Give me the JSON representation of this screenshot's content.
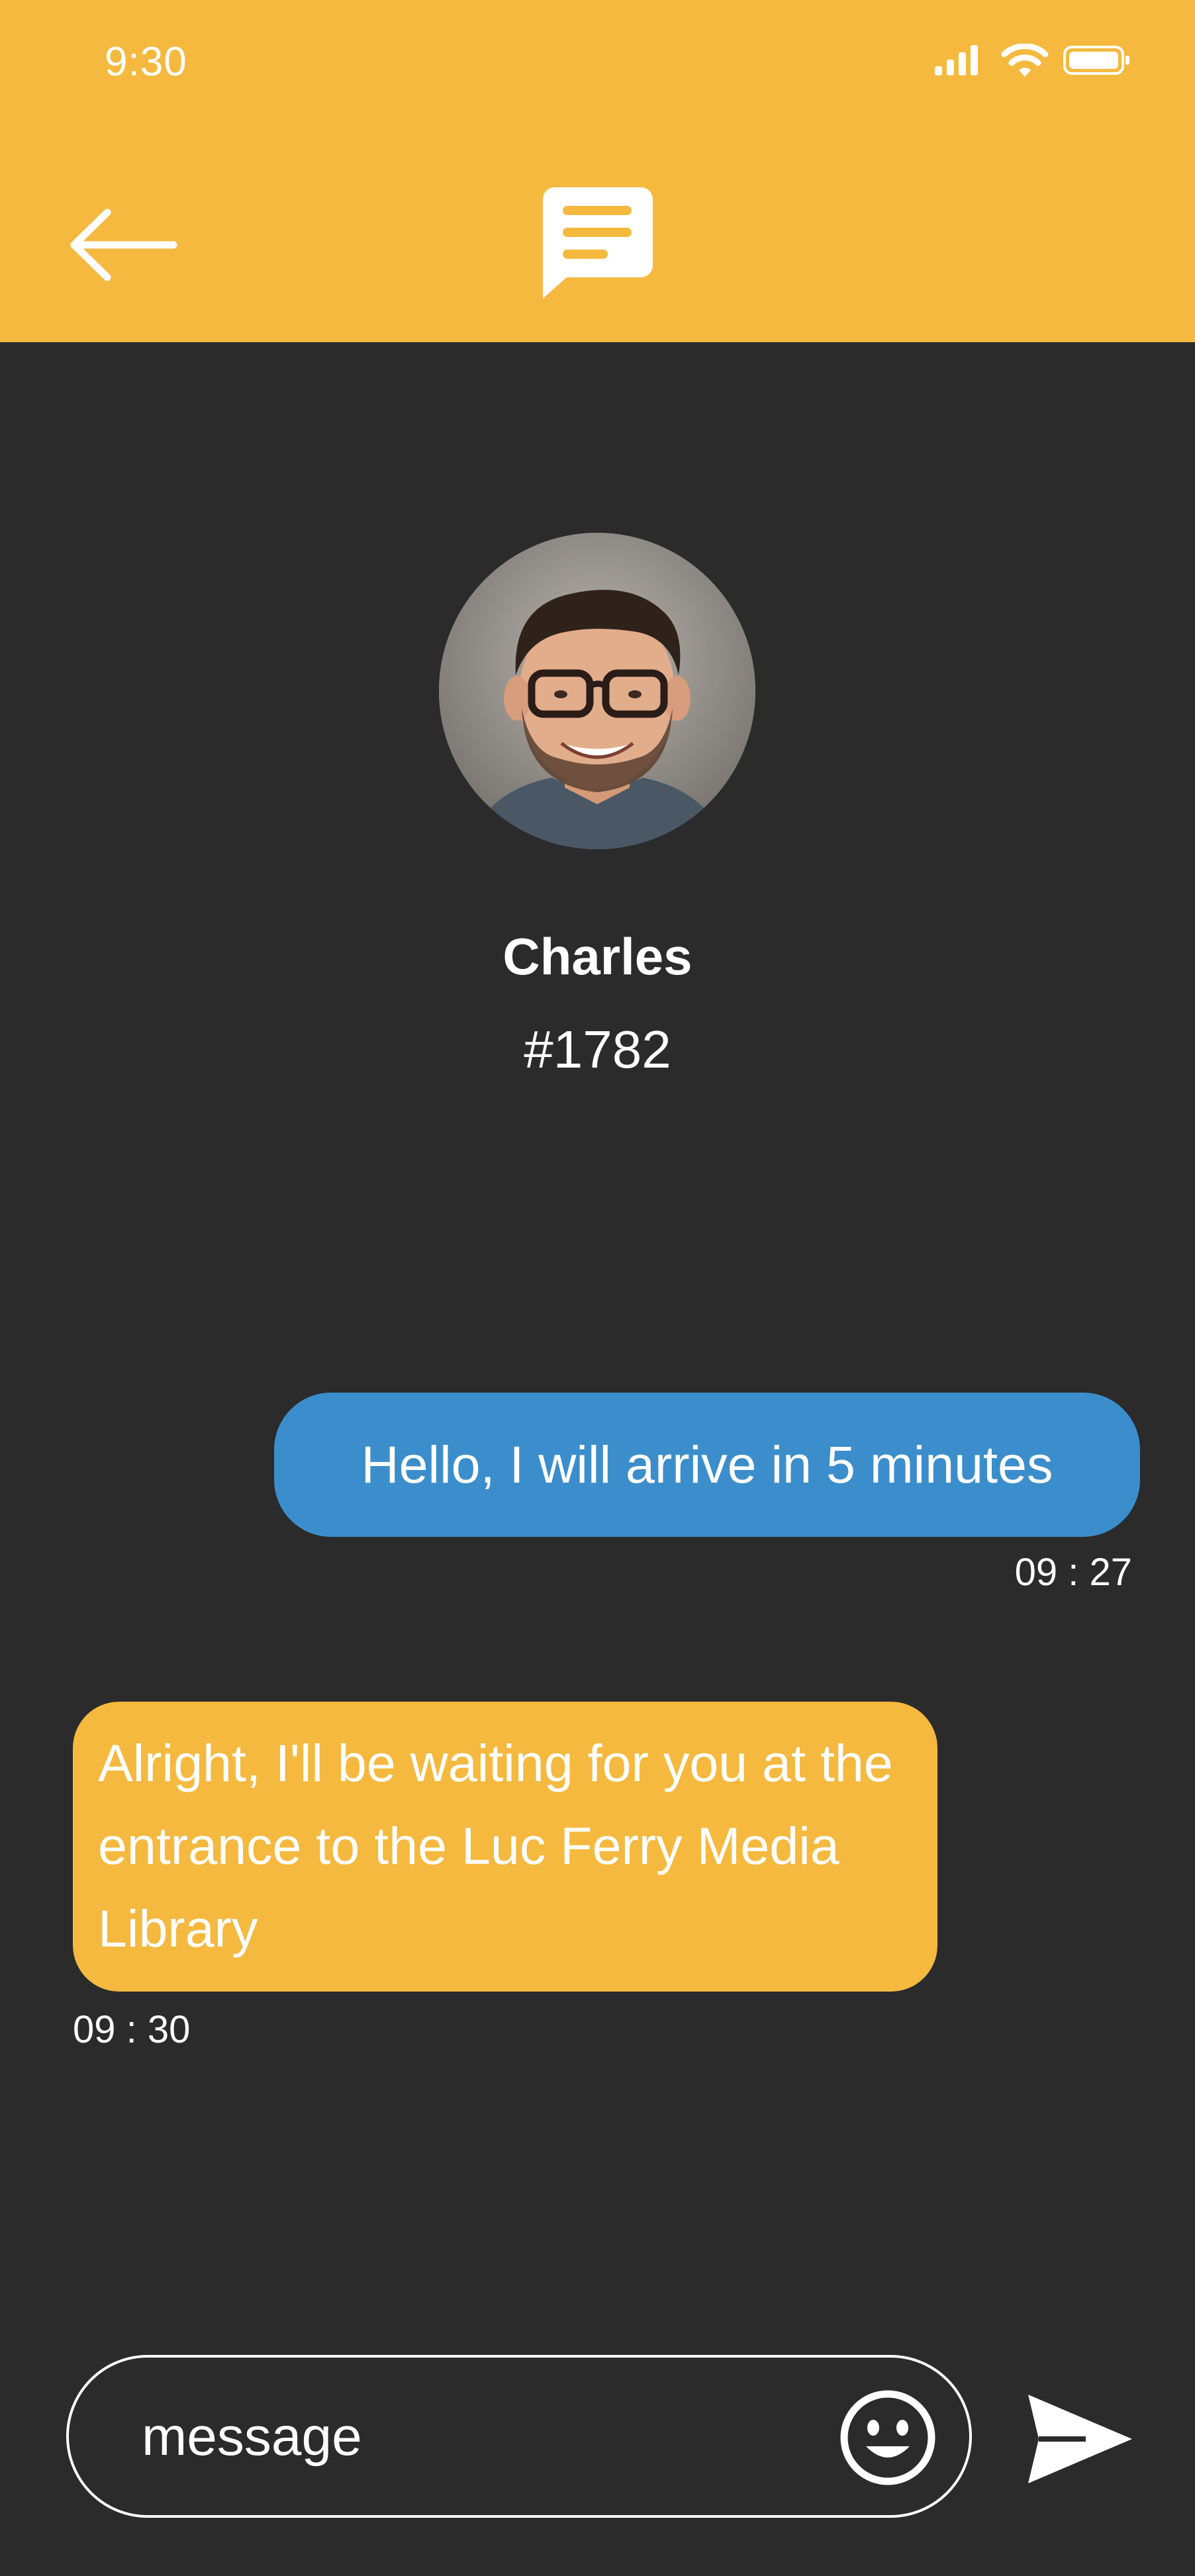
{
  "status_bar": {
    "time": "9:30"
  },
  "header": {
    "back_icon": "arrow-left-icon",
    "logo_icon": "chat-bubble-icon"
  },
  "contact": {
    "name": "Charles",
    "id": "#1782",
    "avatar_icon": "avatar-photo"
  },
  "messages": [
    {
      "direction": "outgoing",
      "text": "Hello, I will arrive in 5 minutes",
      "time": "09 : 27"
    },
    {
      "direction": "incoming",
      "text": "Alright, I'll be waiting for you at the entrance to the Luc Ferry Media Library",
      "time": "09 : 30"
    }
  ],
  "composer": {
    "placeholder": "message",
    "emoji_icon": "smiley-icon",
    "send_icon": "send-icon"
  },
  "colors": {
    "accent": "#f4b93e",
    "background": "#2b2b2b",
    "outgoing_bubble": "#3b8ecb"
  }
}
